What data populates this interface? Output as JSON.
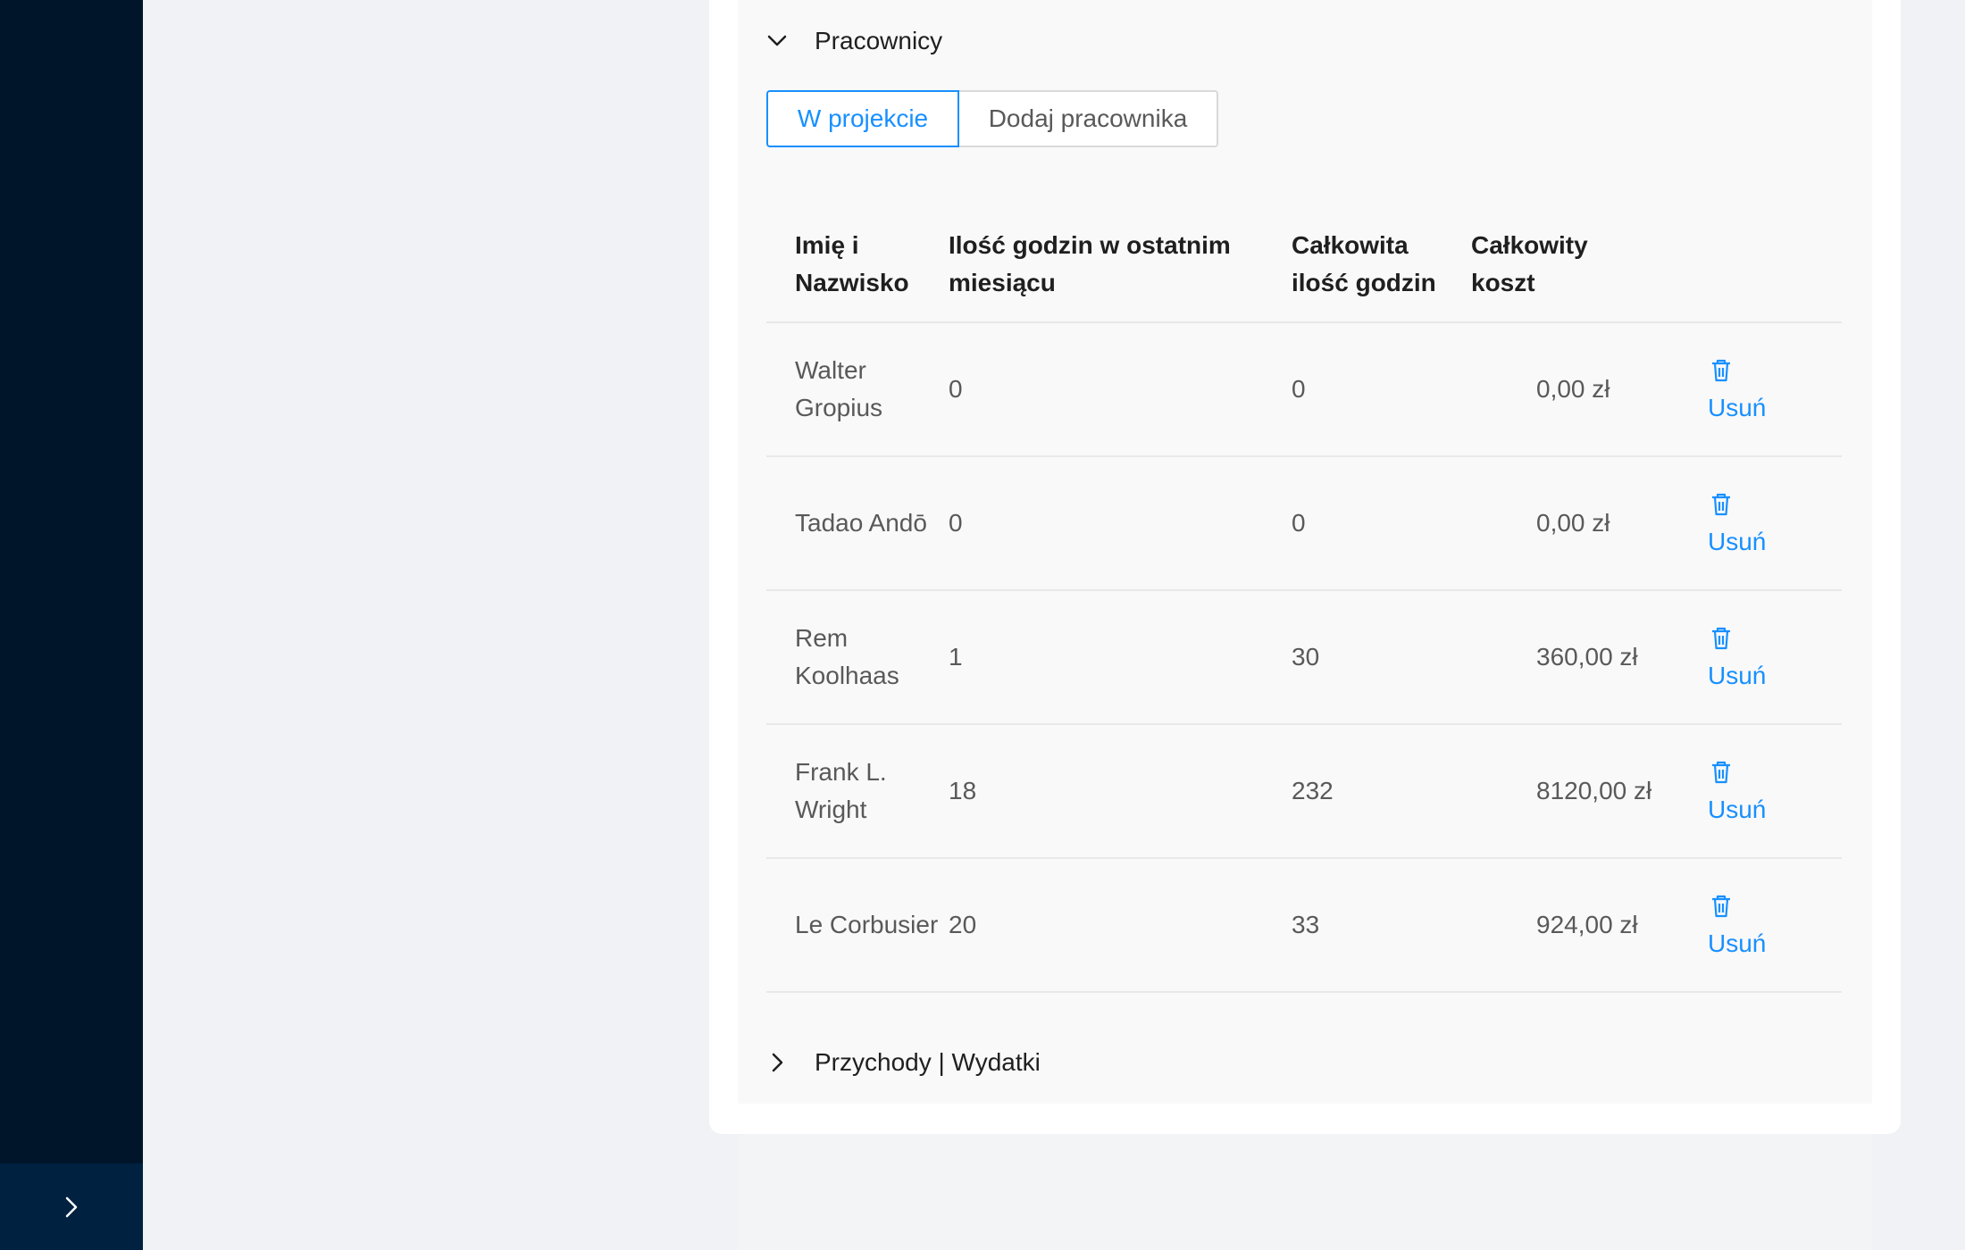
{
  "sidebar": {
    "trigger_icon": "chevron-right-icon"
  },
  "sections": {
    "employees": {
      "title": "Pracownicy",
      "expanded": true,
      "icon": "chevron-down-icon"
    },
    "finance": {
      "title": "Przychody | Wydatki",
      "expanded": false,
      "icon": "chevron-right-icon"
    }
  },
  "tabs": {
    "in_project": "W projekcie",
    "add_employee": "Dodaj pracownika",
    "active": "in_project"
  },
  "table": {
    "headers": {
      "name": "Imię i Nazwisko",
      "hours_last_month": "Ilość godzin w ostatnim miesiącu",
      "total_hours": "Całkowita ilość godzin",
      "total_cost": "Całkowity koszt"
    },
    "rows": [
      {
        "name": "Walter Gropius",
        "hours_last_month": "0",
        "total_hours": "0",
        "total_cost": "0,00 zł",
        "action": "Usuń"
      },
      {
        "name": "Tadao Andō",
        "hours_last_month": "0",
        "total_hours": "0",
        "total_cost": "0,00 zł",
        "action": "Usuń"
      },
      {
        "name": "Rem Koolhaas",
        "hours_last_month": "1",
        "total_hours": "30",
        "total_cost": "360,00 zł",
        "action": "Usuń"
      },
      {
        "name": "Frank L. Wright",
        "hours_last_month": "18",
        "total_hours": "232",
        "total_cost": "8120,00 zł",
        "action": "Usuń"
      },
      {
        "name": "Le Corbusier",
        "hours_last_month": "20",
        "total_hours": "33",
        "total_cost": "924,00 zł",
        "action": "Usuń"
      }
    ]
  },
  "colors": {
    "sidebar": "#001529",
    "sidebar_trigger": "#002140",
    "accent": "#1890ff",
    "page_bg": "#f0f2f5"
  }
}
